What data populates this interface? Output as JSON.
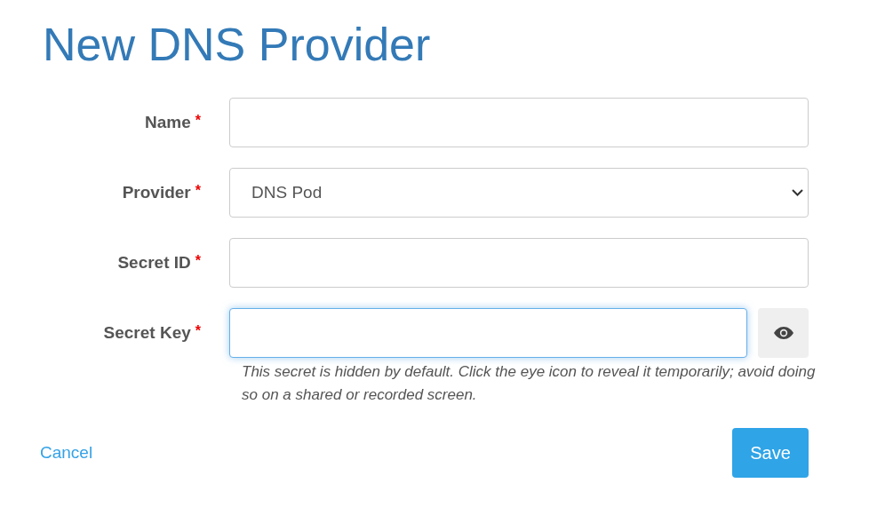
{
  "title": "New DNS Provider",
  "fields": [
    {
      "kind": "text",
      "label": "Name",
      "required": true,
      "focused": false
    },
    {
      "kind": "select",
      "label": "Provider",
      "required": true,
      "focused": false,
      "value": "DNS Pod"
    },
    {
      "kind": "text",
      "label": "Secret ID",
      "required": true,
      "focused": false
    },
    {
      "kind": "secret",
      "label": "Secret Key",
      "required": true,
      "focused": true,
      "help": "This secret is hidden by default. Click the eye icon to reveal it temporarily; avoid doing so on a shared or recorded screen."
    }
  ],
  "required_mark": "*",
  "cancel": "Cancel",
  "save": "Save"
}
